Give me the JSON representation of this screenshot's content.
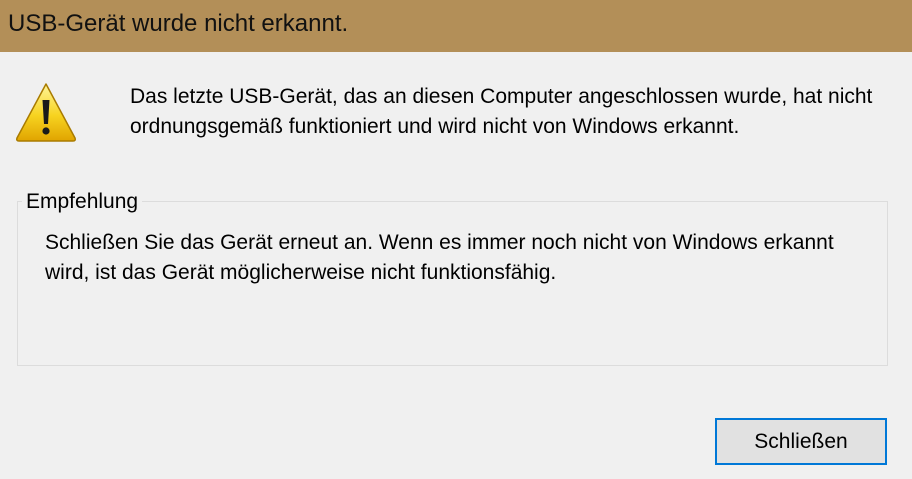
{
  "window": {
    "title": "USB-Gerät wurde nicht erkannt.",
    "title_bar_color": "#b38f58",
    "background_color": "#f0f0f0"
  },
  "message": {
    "icon": "warning-icon",
    "text": "Das letzte USB-Gerät, das an diesen Computer angeschlossen wurde, hat nicht ordnungsgemäß funktioniert und wird nicht von Windows erkannt."
  },
  "recommendation": {
    "heading": "Empfehlung",
    "text": "Schließen Sie das Gerät erneut an. Wenn es immer noch nicht von Windows erkannt wird, ist das Gerät möglicherweise nicht funktionsfähig."
  },
  "buttons": {
    "close_label": "Schließen",
    "focus_color": "#0078d7"
  }
}
